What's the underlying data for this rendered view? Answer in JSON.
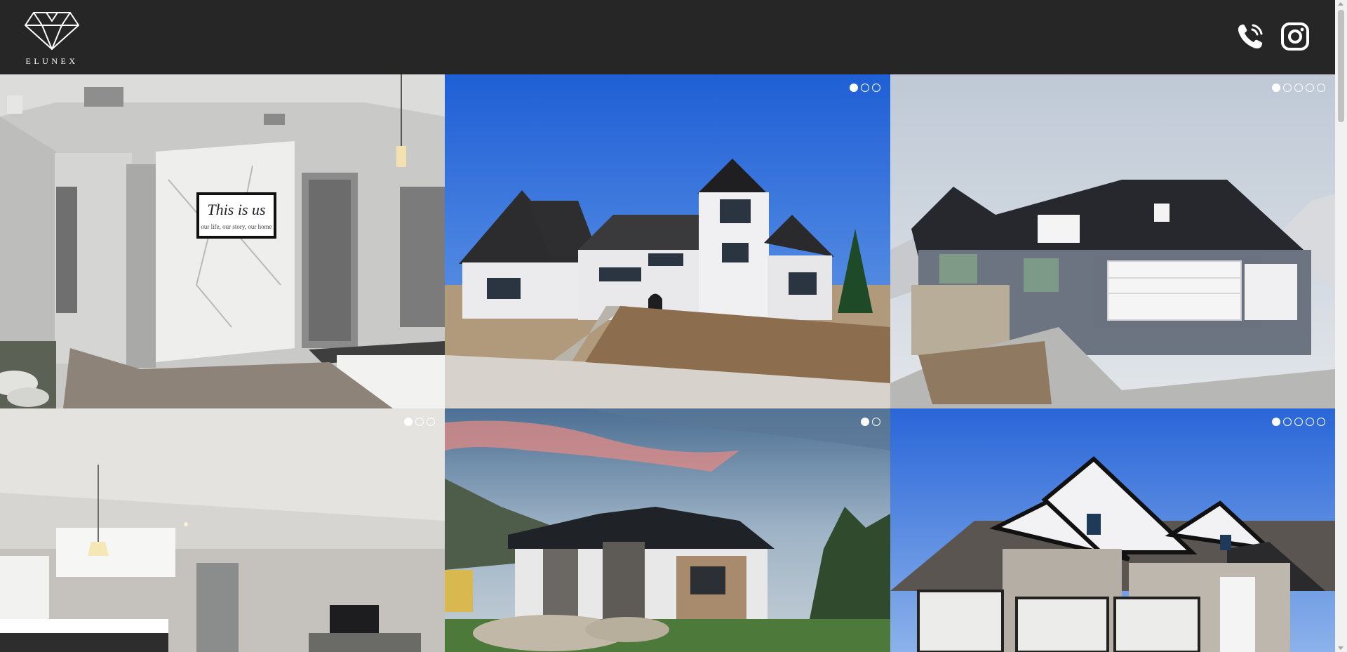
{
  "header": {
    "brand": "ELUNEX",
    "logo_icon": "diamond-logo-icon",
    "phone_icon": "phone-icon",
    "instagram_icon": "instagram-icon",
    "background": "#262626"
  },
  "gallery": {
    "tiles": [
      {
        "name": "interior-hallway-photo",
        "sign_title": "This is us",
        "sign_subtitle": "our life, our story, our home",
        "carousel_count": 0
      },
      {
        "name": "white-farmhouse-construction-photo",
        "carousel_count": 3,
        "active": 1
      },
      {
        "name": "gray-house-garage-photo",
        "carousel_count": 5,
        "active": 1
      },
      {
        "name": "kitchen-interior-photo",
        "carousel_count": 3,
        "active": 1
      },
      {
        "name": "modern-house-sunset-photo",
        "carousel_count": 2,
        "active": 1
      },
      {
        "name": "white-stone-house-photo",
        "carousel_count": 5,
        "active": 1
      }
    ]
  }
}
